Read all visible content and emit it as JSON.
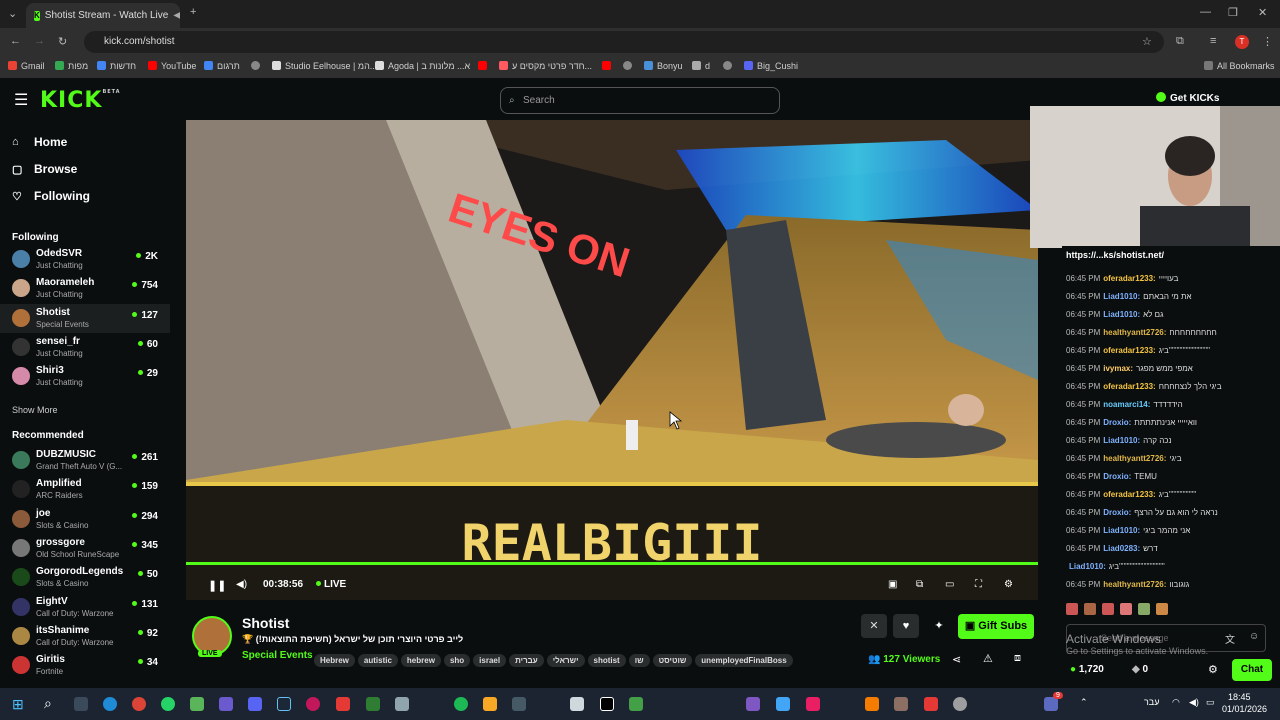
{
  "browser": {
    "tab_title": "Shotist Stream - Watch Live",
    "url": "kick.com/shotist",
    "bookmarks": [
      "Gmail",
      "מפות",
      "חדשות",
      "YouTube",
      "תרגום",
      "",
      "Studio Eelhouse | המ...",
      "Agoda | א... מלונות ב",
      "",
      "חדר פרטי מקסים ע...",
      "",
      "Bonyu",
      "d",
      "",
      "Big_Cushi"
    ],
    "all_bookmarks": "All Bookmarks",
    "profile_letter": "T"
  },
  "header": {
    "logo": "KICK",
    "logo_badge": "BETA",
    "search_placeholder": "Search",
    "get_kicks": "Get KICKs"
  },
  "sidebar": {
    "nav": [
      {
        "label": "Home",
        "icon": "home-icon"
      },
      {
        "label": "Browse",
        "icon": "browse-icon"
      },
      {
        "label": "Following",
        "icon": "heart-icon"
      }
    ],
    "following_title": "Following",
    "following": [
      {
        "name": "OdedSVR",
        "category": "Just Chatting",
        "viewers": "2K",
        "color": "#4a7fa8"
      },
      {
        "name": "Maorameleh",
        "category": "Just Chatting",
        "viewers": "754",
        "color": "#c9a58a"
      },
      {
        "name": "Shotist",
        "category": "Special Events",
        "viewers": "127",
        "color": "#b0703a"
      },
      {
        "name": "sensei_fr",
        "category": "Just Chatting",
        "viewers": "60",
        "color": "#333333"
      },
      {
        "name": "Shiri3",
        "category": "Just Chatting",
        "viewers": "29",
        "color": "#d48aa8"
      }
    ],
    "show_more": "Show More",
    "recommended_title": "Recommended",
    "recommended": [
      {
        "name": "DUBZMUSIC",
        "category": "Grand Theft Auto V (G...",
        "viewers": "261",
        "color": "#3a7a5a"
      },
      {
        "name": "Amplified",
        "category": "ARC Raiders",
        "viewers": "159",
        "color": "#222222"
      },
      {
        "name": "joe",
        "category": "Slots & Casino",
        "viewers": "294",
        "color": "#8a5a3a"
      },
      {
        "name": "grossgore",
        "category": "Old School RuneScape",
        "viewers": "345",
        "color": "#777777"
      },
      {
        "name": "GorgorodLegends",
        "category": "Slots & Casino",
        "viewers": "50",
        "color": "#1a4a1a"
      },
      {
        "name": "EightV",
        "category": "Call of Duty: Warzone",
        "viewers": "131",
        "color": "#333366"
      },
      {
        "name": "itsShanime",
        "category": "Call of Duty: Warzone",
        "viewers": "92",
        "color": "#aa8844"
      },
      {
        "name": "Giritis",
        "category": "Fortnite",
        "viewers": "34",
        "color": "#cc3333"
      }
    ]
  },
  "player": {
    "time": "00:38:56",
    "live": "LIVE",
    "overlay_text": "REALBIGIII",
    "wall_text": "EYES ON"
  },
  "channel": {
    "name": "Shotist",
    "live_badge": "LIVE",
    "title": "לייב פרטי היוצרי תוכן של ישראל (חשיפת התוצאות!) 🏆",
    "category": "Special Events",
    "tags": [
      "Hebrew",
      "autistic",
      "hebrew",
      "sho",
      "israel",
      "עברית",
      "ישראלי",
      "shotist",
      "שו",
      "שוטיסט",
      "unemployedFinalBoss"
    ],
    "viewers": "127 Viewers",
    "gift_subs": "Gift Subs"
  },
  "chat": {
    "link": "https://...ks/shotist.net/",
    "messages": [
      {
        "time": "06:45 PM",
        "user": "oferadar1233:",
        "text": "בעויייי",
        "color": "#f5c542"
      },
      {
        "time": "06:45 PM",
        "user": "Liad1010:",
        "text": "את מי הבאתם",
        "color": "#7fb2ff"
      },
      {
        "time": "06:45 PM",
        "user": "Liad1010:",
        "text": "גם לא",
        "color": "#7fb2ff"
      },
      {
        "time": "06:45 PM",
        "user": "healthyantt2726:",
        "text": "חחחחחחחחח",
        "color": "#e0b84a"
      },
      {
        "time": "06:45 PM",
        "user": "oferadar1233:",
        "text": "ביג'''''''''''''''''''''''''''",
        "color": "#f5c542"
      },
      {
        "time": "06:45 PM",
        "user": "ivymax:",
        "text": "אמפי ממש מפגר",
        "color": "#ffcc66"
      },
      {
        "time": "06:45 PM",
        "user": "oferadar1233:",
        "text": "ביגי הלך לנצחחחח",
        "color": "#f5c542"
      },
      {
        "time": "06:45 PM",
        "user": "noamarci14:",
        "text": "הידדדדד",
        "color": "#66ccff"
      },
      {
        "time": "06:45 PM",
        "user": "Droxio:",
        "text": "וואייייי אנינתתתתת",
        "color": "#7fb2ff"
      },
      {
        "time": "06:45 PM",
        "user": "Liad1010:",
        "text": "נכה קרה",
        "color": "#7fb2ff"
      },
      {
        "time": "06:45 PM",
        "user": "healthyantt2726:",
        "text": "ביגי",
        "color": "#e0b84a"
      },
      {
        "time": "06:45 PM",
        "user": "Droxio:",
        "text": "TEMU",
        "color": "#7fb2ff"
      },
      {
        "time": "06:45 PM",
        "user": "oferadar1233:",
        "text": "ביג''''''''''''''''''",
        "color": "#f5c542"
      },
      {
        "time": "06:45 PM",
        "user": "Droxio:",
        "text": "נראה לי הוא גם על הרצף",
        "color": "#7fb2ff"
      },
      {
        "time": "06:45 PM",
        "user": "Liad1010:",
        "text": "אני מהמר ביגי",
        "color": "#7fb2ff"
      },
      {
        "time": "06:45 PM",
        "user": "Liad0283:",
        "text": "דרש",
        "color": "#7fb2ff"
      },
      {
        "time": "",
        "user": "Liad1010:",
        "text": "ביג''''''''''''''''''''''''''''''",
        "color": "#7fb2ff"
      },
      {
        "time": "06:45 PM",
        "user": "healthyantt2726:",
        "text": "גוגובוו",
        "color": "#e0b84a"
      }
    ],
    "input_placeholder": "Send a message",
    "kicks": "1,720",
    "points": "0",
    "chat_button": "Chat",
    "watermark_title": "Activate Windows",
    "watermark_sub": "Go to Settings to activate Windows."
  },
  "taskbar": {
    "time": "18:45",
    "date": "01/01/2026",
    "lang": "עבר",
    "notif": "9"
  }
}
